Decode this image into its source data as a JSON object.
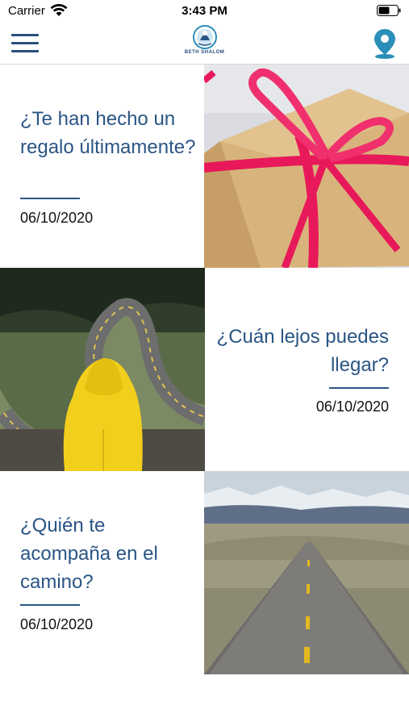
{
  "status_bar": {
    "carrier": "Carrier",
    "time": "3:43 PM"
  },
  "nav": {
    "logo_text": "BETH SHALOM",
    "menu_icon": "hamburger-menu-icon",
    "location_icon": "map-pin-icon",
    "accent_color": "#2a5585",
    "location_color": "#2a8fb8"
  },
  "articles": [
    {
      "title": "¿Te han hecho un regalo últimamente?",
      "date": "06/10/2020",
      "image": "gift-box-with-pink-ribbon"
    },
    {
      "title": "¿Cuán lejos puedes llegar?",
      "date": "06/10/2020",
      "image": "person-in-yellow-raincoat-overlooking-winding-road"
    },
    {
      "title": "¿Quién te acompaña en el camino?",
      "date": "06/10/2020",
      "image": "straight-desert-road-to-mountains"
    }
  ]
}
